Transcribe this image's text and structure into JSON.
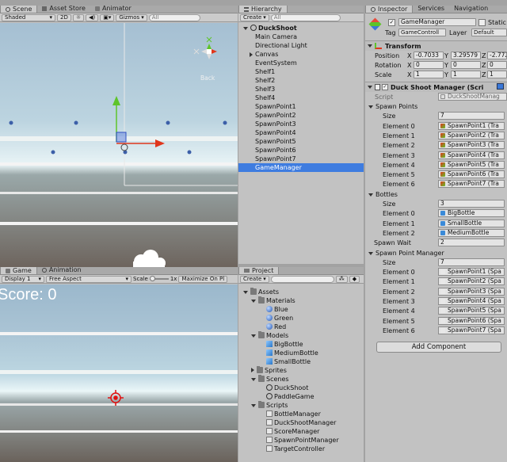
{
  "scene": {
    "tabs": {
      "scene": "Scene",
      "asset_store": "Asset Store",
      "animator": "Animator"
    },
    "toolbar": {
      "shading": "Shaded",
      "mode_2d": "2D",
      "gizmos": "Gizmos",
      "search_placeholder": "All"
    },
    "gizmo_label": "Back"
  },
  "game": {
    "tabs": {
      "game": "Game",
      "animation": "Animation"
    },
    "toolbar": {
      "display": "Display 1",
      "aspect": "Free Aspect",
      "scale_label": "Scale",
      "scale_value": "1x",
      "maximize": "Maximize On Pl"
    },
    "score": "Score: 0"
  },
  "hierarchy": {
    "tab": "Hierarchy",
    "create": "Create",
    "search_placeholder": "All",
    "root": "DuckShoot",
    "items": [
      "Main Camera",
      "Directional Light",
      "Canvas",
      "EventSystem",
      "Shelf1",
      "Shelf2",
      "Shelf3",
      "Shelf4",
      "SpawnPoint1",
      "SpawnPoint2",
      "SpawnPoint3",
      "SpawnPoint4",
      "SpawnPoint5",
      "SpawnPoint6",
      "SpawnPoint7",
      "GameManager"
    ],
    "selected": "GameManager"
  },
  "project": {
    "tab": "Project",
    "create": "Create",
    "tree": [
      {
        "label": "Assets",
        "depth": 0,
        "icon": "folder-icon",
        "expanded": true
      },
      {
        "label": "Materials",
        "depth": 1,
        "icon": "folder-icon",
        "expanded": true
      },
      {
        "label": "Blue",
        "depth": 2,
        "icon": "material-icon"
      },
      {
        "label": "Green",
        "depth": 2,
        "icon": "material-icon"
      },
      {
        "label": "Red",
        "depth": 2,
        "icon": "material-icon"
      },
      {
        "label": "Models",
        "depth": 1,
        "icon": "folder-icon",
        "expanded": true
      },
      {
        "label": "BigBottle",
        "depth": 2,
        "icon": "model-icon"
      },
      {
        "label": "MediumBottle",
        "depth": 2,
        "icon": "model-icon"
      },
      {
        "label": "SmallBottle",
        "depth": 2,
        "icon": "model-icon"
      },
      {
        "label": "Sprites",
        "depth": 1,
        "icon": "folder-icon",
        "collapsed": true
      },
      {
        "label": "Scenes",
        "depth": 1,
        "icon": "folder-icon",
        "expanded": true
      },
      {
        "label": "DuckShoot",
        "depth": 2,
        "icon": "scene-icon"
      },
      {
        "label": "PaddleGame",
        "depth": 2,
        "icon": "scene-icon"
      },
      {
        "label": "Scripts",
        "depth": 1,
        "icon": "folder-icon",
        "expanded": true
      },
      {
        "label": "BottleManager",
        "depth": 2,
        "icon": "script-icon"
      },
      {
        "label": "DuckShootManager",
        "depth": 2,
        "icon": "script-icon"
      },
      {
        "label": "ScoreManager",
        "depth": 2,
        "icon": "script-icon"
      },
      {
        "label": "SpawnPointManager",
        "depth": 2,
        "icon": "script-icon"
      },
      {
        "label": "TargetController",
        "depth": 2,
        "icon": "script-icon"
      }
    ]
  },
  "inspector": {
    "tabs": {
      "inspector": "Inspector",
      "services": "Services",
      "navigation": "Navigation"
    },
    "object_name": "GameManager",
    "static_label": "Static",
    "tag_label": "Tag",
    "tag_value": "GameControll",
    "layer_label": "Layer",
    "layer_value": "Default",
    "transform": {
      "title": "Transform",
      "position": {
        "label": "Position",
        "x": "-0.7033",
        "y": "3.29579",
        "z": "-2.772"
      },
      "rotation": {
        "label": "Rotation",
        "x": "0",
        "y": "0",
        "z": "0"
      },
      "scale": {
        "label": "Scale",
        "x": "1",
        "y": "1",
        "z": "1"
      }
    },
    "component": {
      "title": "Duck Shoot Manager (Scri",
      "script_label": "Script",
      "script_value": "DuckShootManag",
      "size_label": "Size",
      "spawn_points": {
        "title": "Spawn Points",
        "size": "7",
        "elements": [
          {
            "label": "Element 0",
            "value": "SpawnPoint1 (Tra"
          },
          {
            "label": "Element 1",
            "value": "SpawnPoint2 (Tra"
          },
          {
            "label": "Element 2",
            "value": "SpawnPoint3 (Tra"
          },
          {
            "label": "Element 3",
            "value": "SpawnPoint4 (Tra"
          },
          {
            "label": "Element 4",
            "value": "SpawnPoint5 (Tra"
          },
          {
            "label": "Element 5",
            "value": "SpawnPoint6 (Tra"
          },
          {
            "label": "Element 6",
            "value": "SpawnPoint7 (Tra"
          }
        ]
      },
      "bottles": {
        "title": "Bottles",
        "size": "3",
        "elements": [
          {
            "label": "Element 0",
            "value": "BigBottle"
          },
          {
            "label": "Element 1",
            "value": "SmallBottle"
          },
          {
            "label": "Element 2",
            "value": "MediumBottle"
          }
        ]
      },
      "spawn_wait": {
        "label": "Spawn Wait",
        "value": "2"
      },
      "spawn_point_manager": {
        "title": "Spawn Point Manager",
        "size": "7",
        "elements": [
          {
            "label": "Element 0",
            "value": "SpawnPoint1 (Spa"
          },
          {
            "label": "Element 1",
            "value": "SpawnPoint2 (Spa"
          },
          {
            "label": "Element 2",
            "value": "SpawnPoint3 (Spa"
          },
          {
            "label": "Element 3",
            "value": "SpawnPoint4 (Spa"
          },
          {
            "label": "Element 4",
            "value": "SpawnPoint5 (Spa"
          },
          {
            "label": "Element 5",
            "value": "SpawnPoint6 (Spa"
          },
          {
            "label": "Element 6",
            "value": "SpawnPoint7 (Spa"
          }
        ]
      }
    },
    "add_component": "Add Component"
  },
  "colors": {
    "selection": "#3e7ce0",
    "axis_x": "#e0361c",
    "axis_y": "#5ec42a",
    "panel": "#c2c2c2",
    "sky": "#a7c3d6",
    "floor": "#6b6259"
  }
}
